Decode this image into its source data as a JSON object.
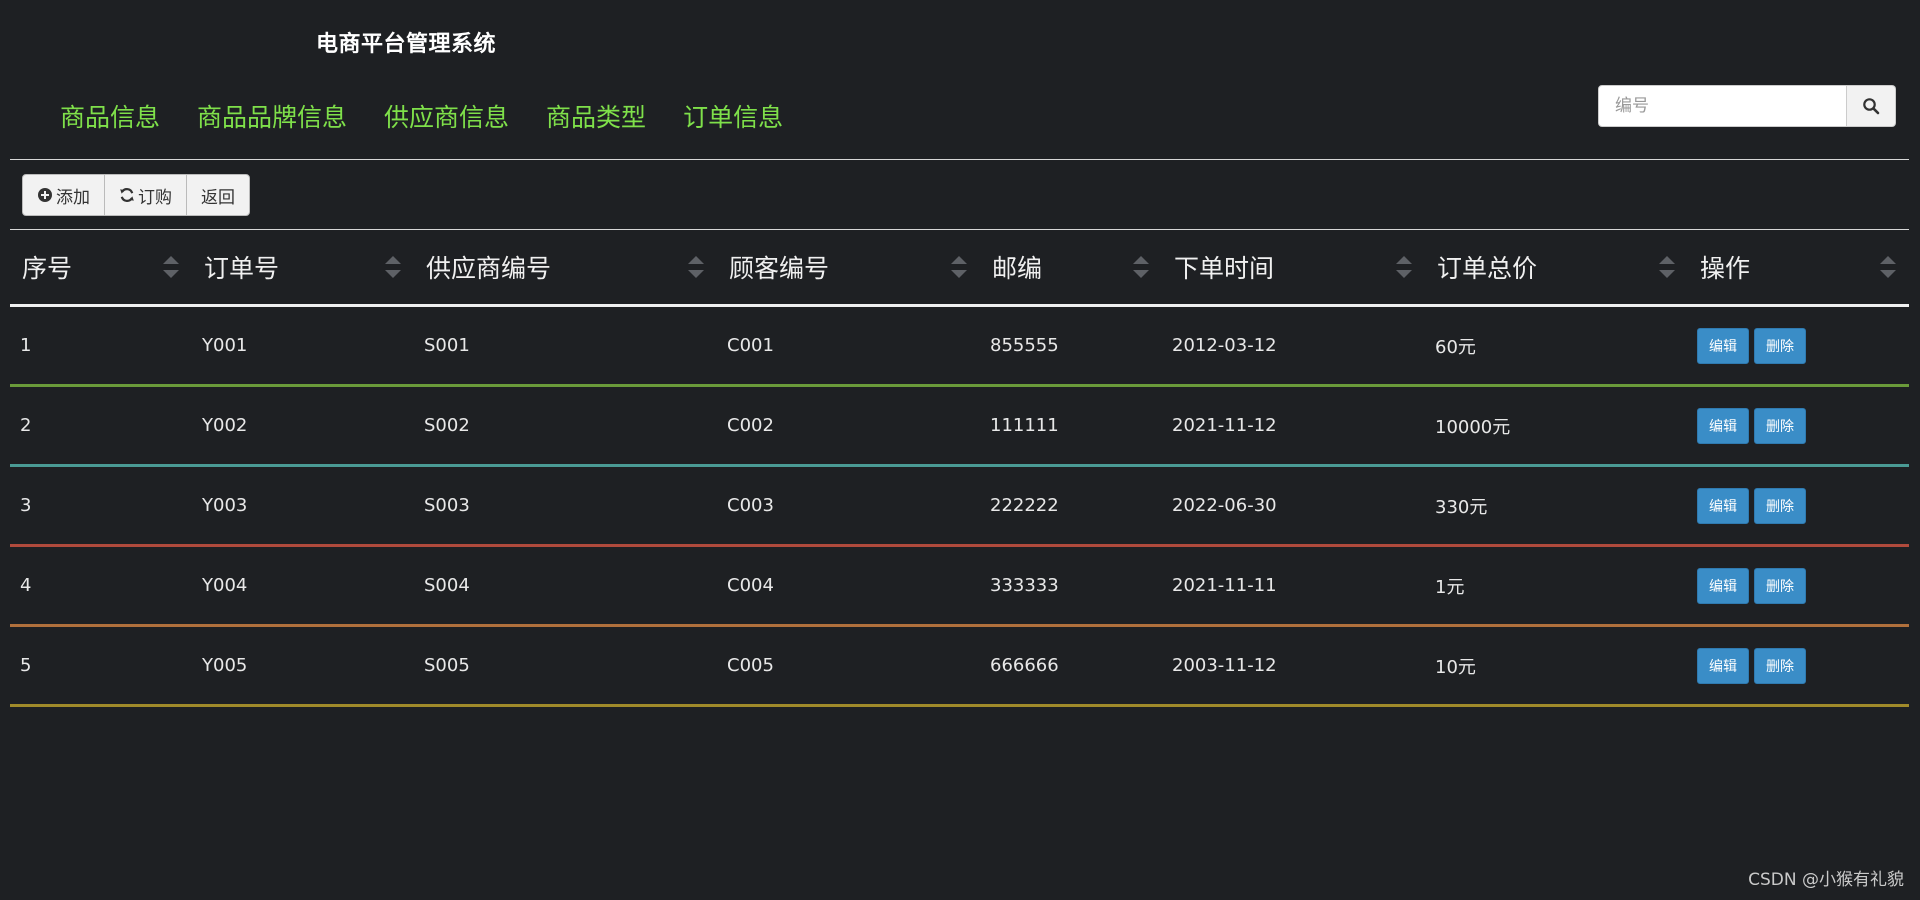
{
  "app": {
    "title": "电商平台管理系统"
  },
  "nav": {
    "items": [
      {
        "label": "商品信息"
      },
      {
        "label": "商品品牌信息"
      },
      {
        "label": "供应商信息"
      },
      {
        "label": "商品类型"
      },
      {
        "label": "订单信息"
      }
    ]
  },
  "search": {
    "placeholder": "编号",
    "value": "",
    "button_icon": "search-icon"
  },
  "toolbar": {
    "add_label": "添加",
    "add_icon": "plus-circle-icon",
    "order_label": "订购",
    "order_icon": "refresh-icon",
    "back_label": "返回"
  },
  "table": {
    "columns": [
      "序号",
      "订单号",
      "供应商编号",
      "顾客编号",
      "邮编",
      "下单时间",
      "订单总价",
      "操作"
    ],
    "rows": [
      {
        "cells": [
          "1",
          "Y001",
          "S001",
          "C001",
          "855555",
          "2012-03-12",
          "60元"
        ],
        "divider_color": "#6a9a3a"
      },
      {
        "cells": [
          "2",
          "Y002",
          "S002",
          "C002",
          "111111",
          "2021-11-12",
          "10000元"
        ],
        "divider_color": "#4a9a94"
      },
      {
        "cells": [
          "3",
          "Y003",
          "S003",
          "C003",
          "222222",
          "2022-06-30",
          "330元"
        ],
        "divider_color": "#b04a3c"
      },
      {
        "cells": [
          "4",
          "Y004",
          "S004",
          "C004",
          "333333",
          "2021-11-11",
          "1元"
        ],
        "divider_color": "#b0703c"
      },
      {
        "cells": [
          "5",
          "Y005",
          "S005",
          "C005",
          "666666",
          "2003-11-12",
          "10元"
        ],
        "divider_color": "#a08a2a"
      }
    ],
    "edit_label": "编辑",
    "delete_label": "删除"
  },
  "watermark": "CSDN @小猴有礼貌",
  "colors": {
    "background": "#1e2023",
    "nav_text": "#7fe04a",
    "action_button": "#3a8dc7"
  }
}
